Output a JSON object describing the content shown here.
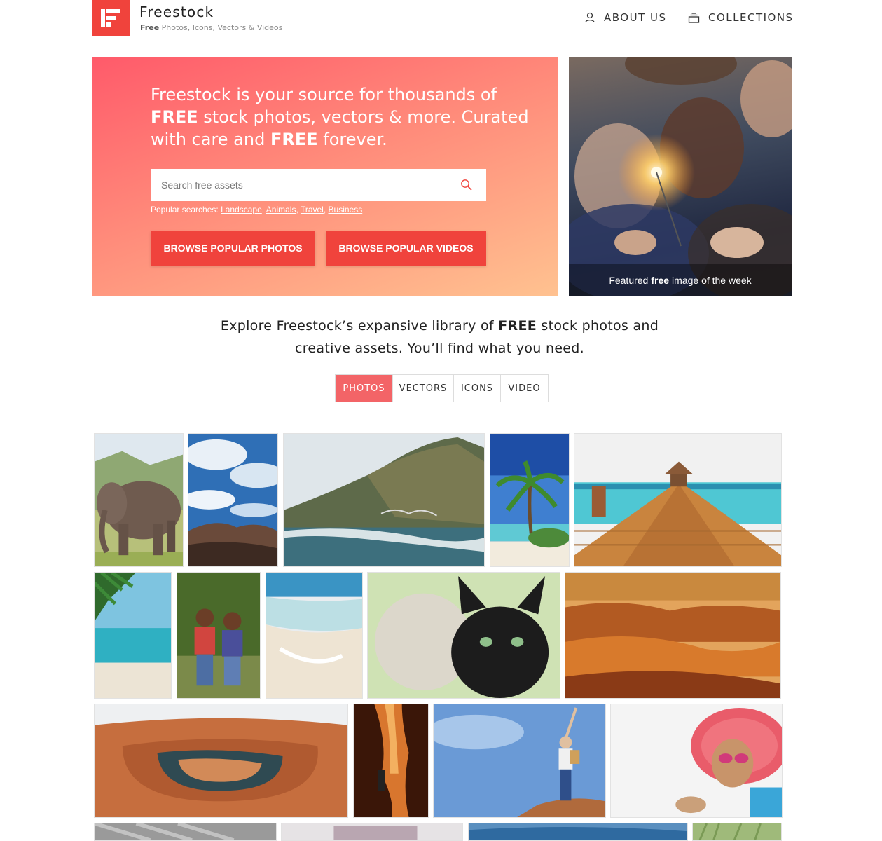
{
  "header": {
    "brand_name": "Freestock",
    "tagline_bold": "Free",
    "tagline_rest": " Photos, Icons, Vectors & Videos",
    "nav": {
      "about": "ABOUT US",
      "collections": "COLLECTIONS"
    },
    "icons": {
      "about": "user-icon",
      "collections": "stack-icon"
    }
  },
  "hero": {
    "heading": {
      "part1": "Freestock is your source for thousands of ",
      "bold1": "FREE",
      "part2": " stock photos, vectors & more. Curated with care and ",
      "bold2": "FREE",
      "part3": " forever."
    },
    "search": {
      "placeholder": "Search free assets",
      "value": ""
    },
    "popular_label": "Popular searches: ",
    "popular_links": [
      "Landscape",
      "Animals",
      "Travel",
      "Business"
    ],
    "buttons": {
      "photos": "BROWSE POPULAR PHOTOS",
      "videos": "BROWSE POPULAR VIDEOS"
    },
    "featured_caption": {
      "before": "Featured",
      "bold": "free",
      "after": "image of the week"
    }
  },
  "explore": {
    "part1": "Explore Freestock’s expansive library of ",
    "bold": "FREE",
    "part2": " stock photos and creative assets. You’ll find what you need."
  },
  "tabs": {
    "photos": "PHOTOS",
    "vectors": "VECTORS",
    "icons": "ICONS",
    "video": "VIDEO",
    "active": "photos"
  },
  "colors": {
    "brand": "#f0433c",
    "tab_active": "#f36467",
    "hero_gradient_start": "#ff5a6a",
    "hero_gradient_end": "#ffc290"
  }
}
